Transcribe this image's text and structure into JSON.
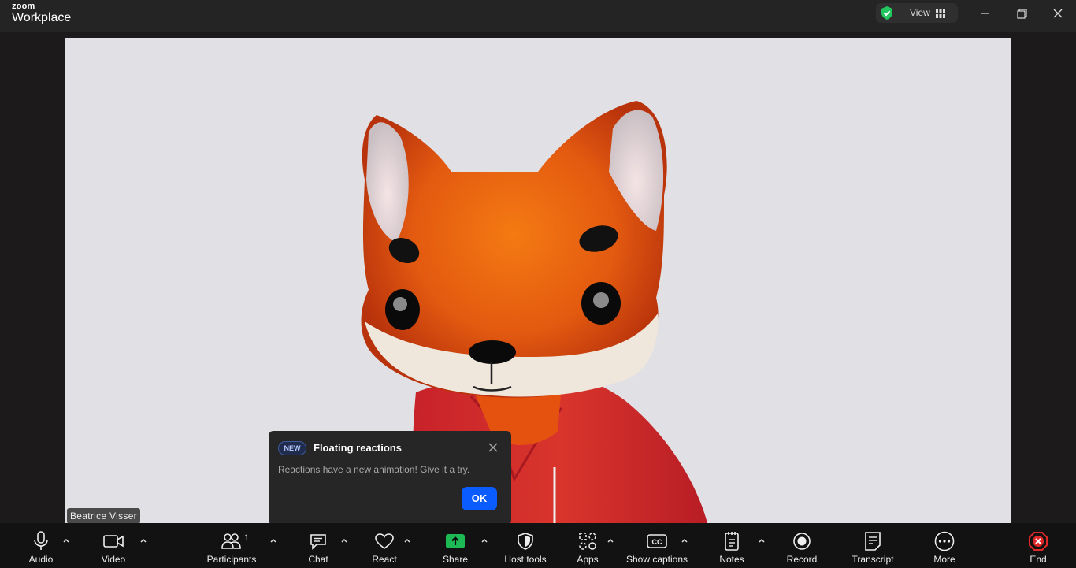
{
  "app": {
    "brand_top": "zoom",
    "brand_bottom": "Workplace"
  },
  "titlebar": {
    "view_label": "View",
    "icons": [
      "shield-check-icon",
      "grid-icon",
      "minimize-icon",
      "restore-icon",
      "close-icon"
    ]
  },
  "participant": {
    "name": "Beatrice Visser",
    "avatar": "fox-avatar"
  },
  "popup": {
    "badge": "NEW",
    "title": "Floating reactions",
    "description": "Reactions have a new animation! Give it a try.",
    "ok_label": "OK"
  },
  "toolbar": {
    "audio": "Audio",
    "video": "Video",
    "participants": "Participants",
    "participants_count": "1",
    "chat": "Chat",
    "react": "React",
    "share": "Share",
    "host_tools": "Host tools",
    "apps": "Apps",
    "show_captions": "Show captions",
    "notes": "Notes",
    "record": "Record",
    "transcript": "Transcript",
    "more": "More",
    "end": "End"
  },
  "colors": {
    "accent": "#0b5cff",
    "share_green": "#1db954",
    "end_red": "#e02828",
    "shield_green": "#22c55e",
    "toolbar_bg": "#121212"
  }
}
